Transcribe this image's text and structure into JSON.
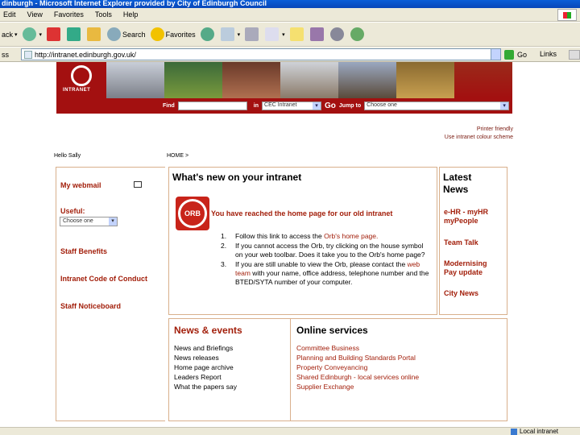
{
  "window": {
    "title": "dinburgh - Microsoft Internet Explorer provided by City of Edinburgh Council"
  },
  "menu": [
    "Edit",
    "View",
    "Favorites",
    "Tools",
    "Help"
  ],
  "toolbar": {
    "back": "ack",
    "search": "Search",
    "favorites": "Favorites"
  },
  "address": {
    "label": "ss",
    "url": "http://intranet.edinburgh.gov.uk/",
    "go": "Go",
    "links": "Links"
  },
  "banner": {
    "logo_text": "INTRANET",
    "find_label": "Find",
    "in_label": "in",
    "in_value": "CEC Intranet",
    "go": "Go",
    "jump_label": "Jump to",
    "jump_value": "Choose one"
  },
  "header_links": {
    "printer": "Printer friendly",
    "home_scheme": "Use intranet colour scheme"
  },
  "greeting": "Hello Sally",
  "breadcrumb": "HOME >",
  "left_nav": {
    "webmail": "My webmail",
    "useful_label": "Useful:",
    "useful_select": "Choose one",
    "links": [
      "Staff Benefits",
      "Intranet Code of Conduct",
      "Staff Noticeboard"
    ]
  },
  "whats_new": {
    "heading": "What's new on your intranet",
    "orb_logo": "ORB",
    "orb_heading": "You have reached the home page for our old intranet",
    "steps": [
      {
        "num": "1.",
        "pre": "Follow this link to access the ",
        "link": "Orb's home page.",
        "post": ""
      },
      {
        "num": "2.",
        "pre": "If you cannot access the Orb, try clicking on the house symbol on your web toolbar. Does it take you to the Orb's home page?",
        "link": "",
        "post": ""
      },
      {
        "num": "3.",
        "pre": "If you are still unable to view the Orb, please contact the ",
        "link": "web team",
        "post": " with your name, office address, telephone number and the BTED/SYTA number of your computer."
      }
    ]
  },
  "latest_news": {
    "heading": "Latest News",
    "items": [
      "e-HR - myHR myPeople",
      "Team Talk",
      "Modernising Pay update",
      "City News"
    ]
  },
  "news_events": {
    "heading": "News & events",
    "items": [
      "News and Briefings",
      "News releases",
      "Home page archive",
      "Leaders Report",
      "What the papers say"
    ]
  },
  "online_services": {
    "heading": "Online services",
    "items": [
      "Committee Business",
      "Planning and Building Standards Portal",
      "Property Conveyancing",
      "Shared Edinburgh - local services online",
      "Supplier Exchange"
    ]
  },
  "status": {
    "zone": "Local intranet"
  },
  "colors": {
    "brand_red": "#a31010",
    "link_red": "#a21e0a",
    "border": "#d9b08c"
  }
}
